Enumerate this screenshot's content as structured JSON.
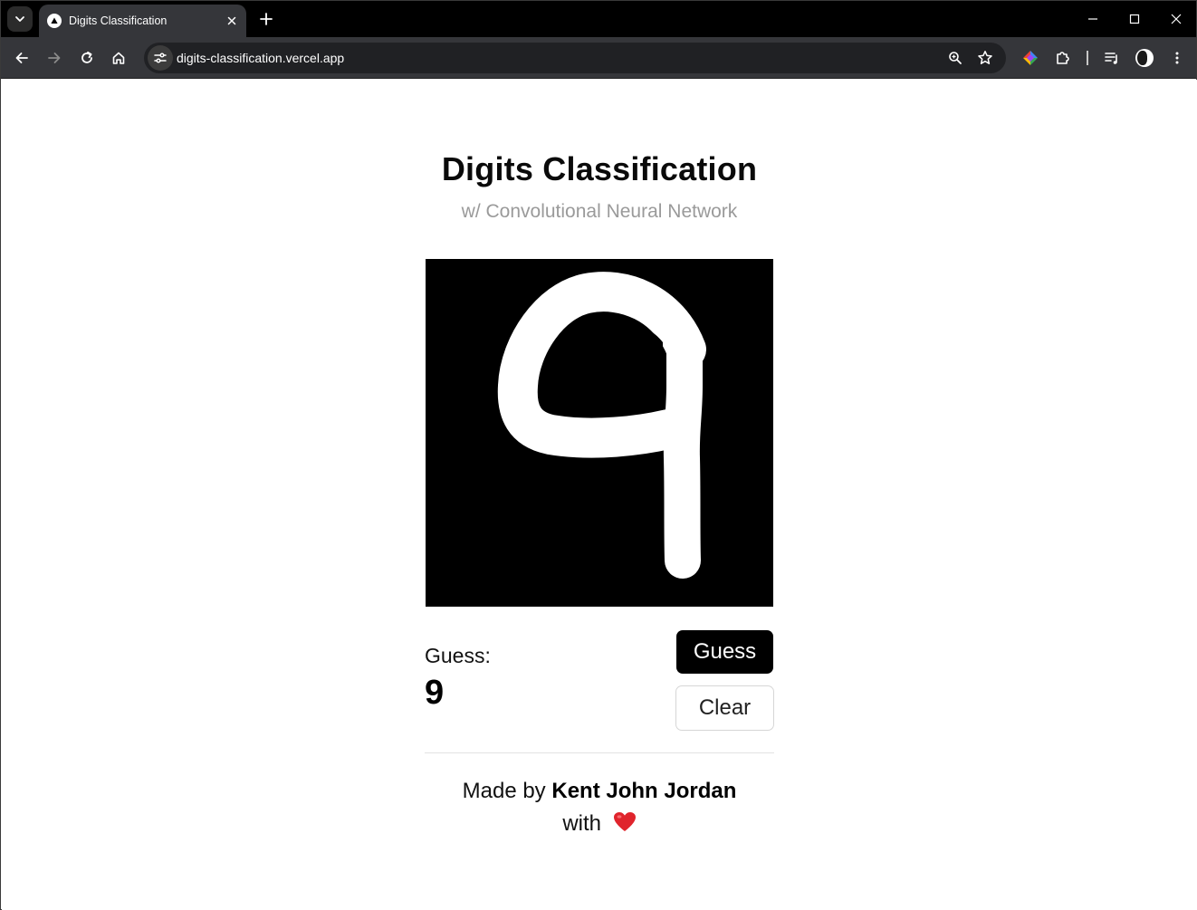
{
  "browser": {
    "tab": {
      "title": "Digits Classification"
    },
    "address_bar": {
      "url": "digits-classification.vercel.app"
    }
  },
  "page": {
    "title": "Digits Classification",
    "subtitle": "w/ Convolutional Neural Network",
    "canvas": {
      "drawn_digit": "9",
      "background_color": "#000000",
      "stroke_color": "#ffffff"
    },
    "result": {
      "label": "Guess:",
      "value": "9"
    },
    "buttons": {
      "guess": "Guess",
      "clear": "Clear"
    },
    "footer": {
      "made_by_prefix": "Made by",
      "author": "Kent John Jordan",
      "with_text": "with",
      "heart_icon": "heart-icon",
      "heart_color": "#e0242c"
    }
  },
  "colors": {
    "tabstrip": "#000000",
    "toolbar": "#35363a",
    "omnibox": "#202124",
    "primary_button": "#000000",
    "subtitle": "#9a9a9a"
  }
}
